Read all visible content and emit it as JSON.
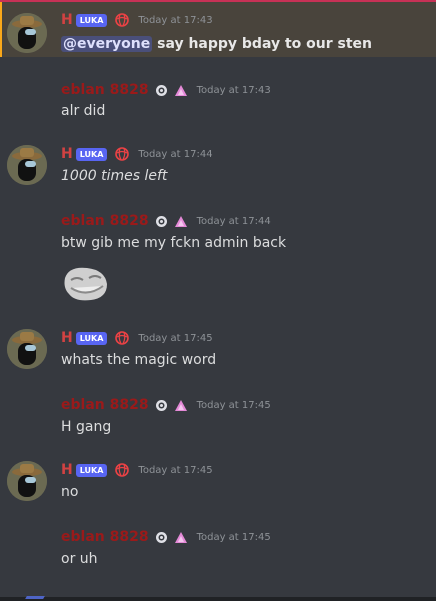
{
  "users": {
    "h": {
      "name": "H",
      "role_tag": "LUKA"
    },
    "e": {
      "name": "eblan 8828"
    }
  },
  "messages": [
    {
      "user": "h",
      "time": "Today at 17:43",
      "mention": "@everyone",
      "text": " say happy bday to our sten"
    },
    {
      "user": "e",
      "time": "Today at 17:43",
      "text": "alr did"
    },
    {
      "user": "h",
      "time": "Today at 17:44",
      "text": "1000 times left"
    },
    {
      "user": "e",
      "time": "Today at 17:44",
      "text": "btw gib me my fckn admin back"
    },
    {
      "user": "h",
      "time": "Today at 17:45",
      "text": "whats the magic word"
    },
    {
      "user": "e",
      "time": "Today at 17:45",
      "text": "H gang"
    },
    {
      "user": "h",
      "time": "Today at 17:45",
      "text": "no"
    },
    {
      "user": "e",
      "time": "Today at 17:45",
      "text": "or uh"
    }
  ],
  "icons": {
    "h_header": [
      "globe-icon"
    ],
    "e_header": [
      "nitro-badge-icon",
      "booster-icon"
    ],
    "emoji": "trollface-emoji"
  },
  "colors": {
    "background": "#36393f",
    "mention_highlight": "#49443c",
    "mention_bar": "#faa81a",
    "role_tag": "#5865f2",
    "username_h": "#d24242",
    "username_e": "#9a1a1a",
    "timestamp": "#8e9297",
    "text": "#dcddde"
  }
}
